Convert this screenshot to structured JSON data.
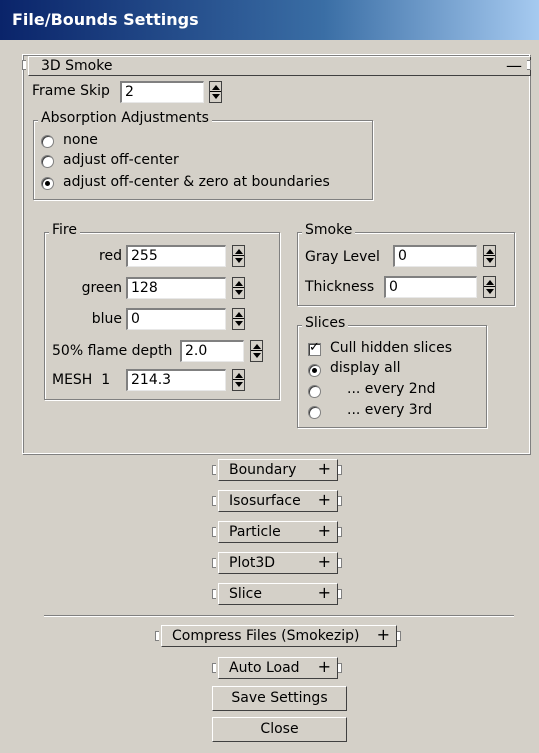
{
  "window": {
    "title": "File/Bounds Settings"
  },
  "smoke3d": {
    "header": "3D Smoke",
    "collapse_sign": "—",
    "frame_skip": {
      "label": "Frame Skip",
      "value": "2"
    },
    "absorption": {
      "title": "Absorption Adjustments",
      "options": [
        "none",
        "adjust off-center",
        "adjust off-center & zero at boundaries"
      ],
      "selected": 2
    },
    "fire": {
      "title": "Fire",
      "red": {
        "label": "red",
        "value": "255"
      },
      "green": {
        "label": "green",
        "value": "128"
      },
      "blue": {
        "label": "blue",
        "value": "0"
      },
      "flame_depth": {
        "label": "50% flame depth",
        "value": "2.0"
      },
      "mesh": {
        "label": "MESH  1",
        "value": "214.3"
      }
    },
    "smoke": {
      "title": "Smoke",
      "gray_level": {
        "label": "Gray Level",
        "value": "0"
      },
      "thickness": {
        "label": "Thickness",
        "value": "0"
      }
    },
    "slices": {
      "title": "Slices",
      "cull_hidden": {
        "label": "Cull hidden slices",
        "checked": true
      },
      "options": [
        "display all",
        "... every 2nd",
        "... every 3rd"
      ],
      "selected": 0
    }
  },
  "rollouts": {
    "expand_sign": "+",
    "boundary": "Boundary",
    "isosurface": "Isosurface",
    "particle": "Particle",
    "plot3d": "Plot3D",
    "slice": "Slice",
    "compress": "Compress Files (Smokezip)",
    "auto_load": "Auto Load"
  },
  "buttons": {
    "save": "Save Settings",
    "close": "Close"
  }
}
